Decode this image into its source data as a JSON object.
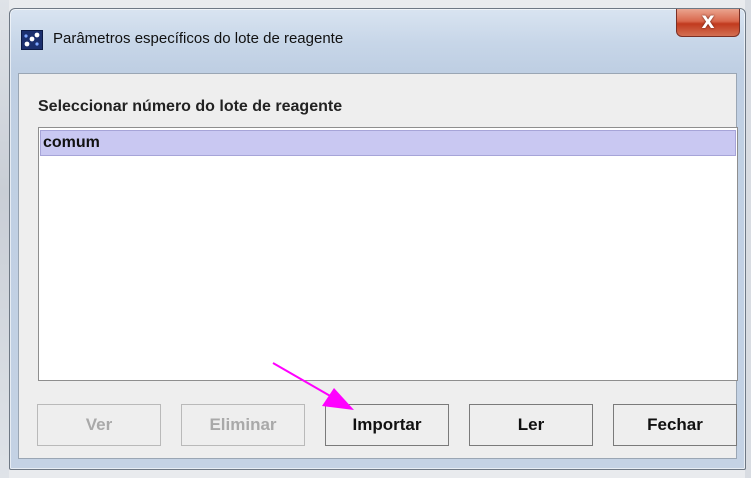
{
  "window": {
    "title": "Parâmetros específicos do lote de reagente",
    "close_glyph": "X",
    "app_icon": "app-dots-icon"
  },
  "dialog": {
    "list_label": "Seleccionar número do lote de reagente",
    "lots": [
      {
        "label": "comum",
        "selected": true
      }
    ]
  },
  "buttons": {
    "ver": {
      "label": "Ver",
      "enabled": false
    },
    "eliminar": {
      "label": "Eliminar",
      "enabled": false
    },
    "importar": {
      "label": "Importar",
      "enabled": true
    },
    "ler": {
      "label": "Ler",
      "enabled": true
    },
    "fechar": {
      "label": "Fechar",
      "enabled": true
    }
  },
  "annotation": {
    "icon": "pointer-arrow-icon",
    "color": "#ff00ff",
    "points_to": "importar"
  },
  "colors": {
    "selection": "#c9c8f2",
    "close_button": "#c13a1e",
    "window_frame": "#c7d6e8"
  }
}
